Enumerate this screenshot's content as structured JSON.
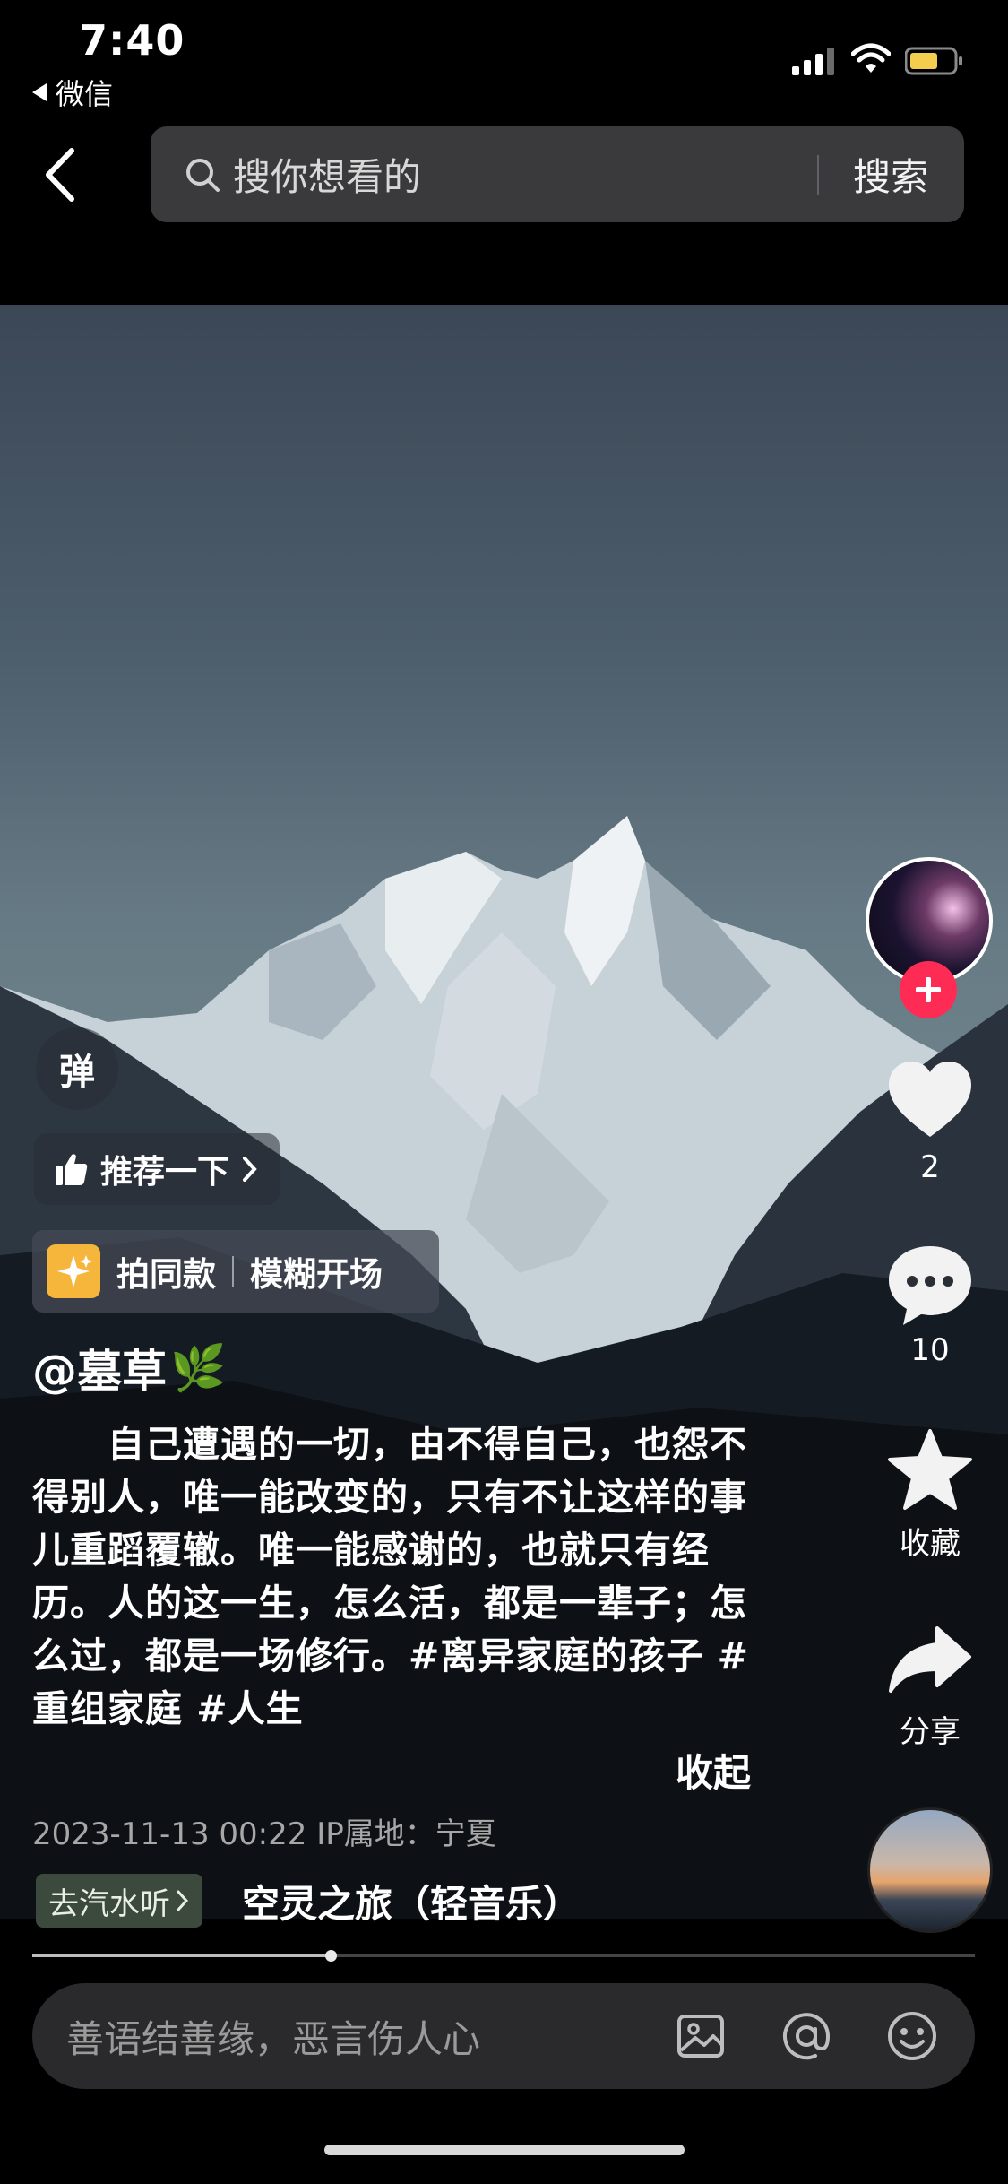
{
  "status_bar": {
    "time": "7:40",
    "back_app": "微信"
  },
  "header": {
    "search_placeholder": "搜你想看的",
    "search_button": "搜索"
  },
  "overlay": {
    "danmu_label": "弹",
    "recommend_label": "推荐一下",
    "same_style_label": "拍同款",
    "same_style_effect": "模糊开场",
    "author": "@墓草",
    "author_emoji": "🌿",
    "caption": "　　自己遭遇的一切，由不得自己，也怨不得别人，唯一能改变的，只有不让这样的事儿重蹈覆辙。唯一能感谢的，也就只有经历。人的这一生，怎么活，都是一辈子；怎么过，都是一场修行。#离异家庭的孩子 #重组家庭 #人生",
    "collapse_label": "收起",
    "meta": "2023-11-13 00:22   IP属地：宁夏",
    "music_tag": "去汽水听",
    "music_title": "空灵之旅（轻音乐）"
  },
  "actions": {
    "like_count": "2",
    "comment_count": "10",
    "favorite_label": "收藏",
    "share_label": "分享"
  },
  "playback": {
    "progress": 0.317
  },
  "comment_bar": {
    "placeholder": "善语结善缘，恶言伤人心"
  },
  "colors": {
    "follow_accent": "#fe2c55",
    "music_tag_bg": "#3c4a3e"
  }
}
